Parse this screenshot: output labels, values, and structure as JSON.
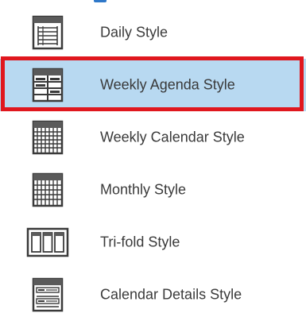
{
  "print_styles": {
    "items": [
      {
        "label": "Daily Style",
        "icon": "daily-style-icon",
        "selected": false
      },
      {
        "label": "Weekly Agenda Style",
        "icon": "weekly-agenda-style-icon",
        "selected": true
      },
      {
        "label": "Weekly Calendar Style",
        "icon": "weekly-calendar-style-icon",
        "selected": false
      },
      {
        "label": "Monthly Style",
        "icon": "monthly-style-icon",
        "selected": false
      },
      {
        "label": "Tri-fold Style",
        "icon": "tri-fold-style-icon",
        "selected": false
      },
      {
        "label": "Calendar Details Style",
        "icon": "calendar-details-style-icon",
        "selected": false
      }
    ],
    "colors": {
      "selected_background": "#b8d9f1",
      "selection_outline": "#e0171e",
      "text": "#3a3a3a"
    }
  }
}
